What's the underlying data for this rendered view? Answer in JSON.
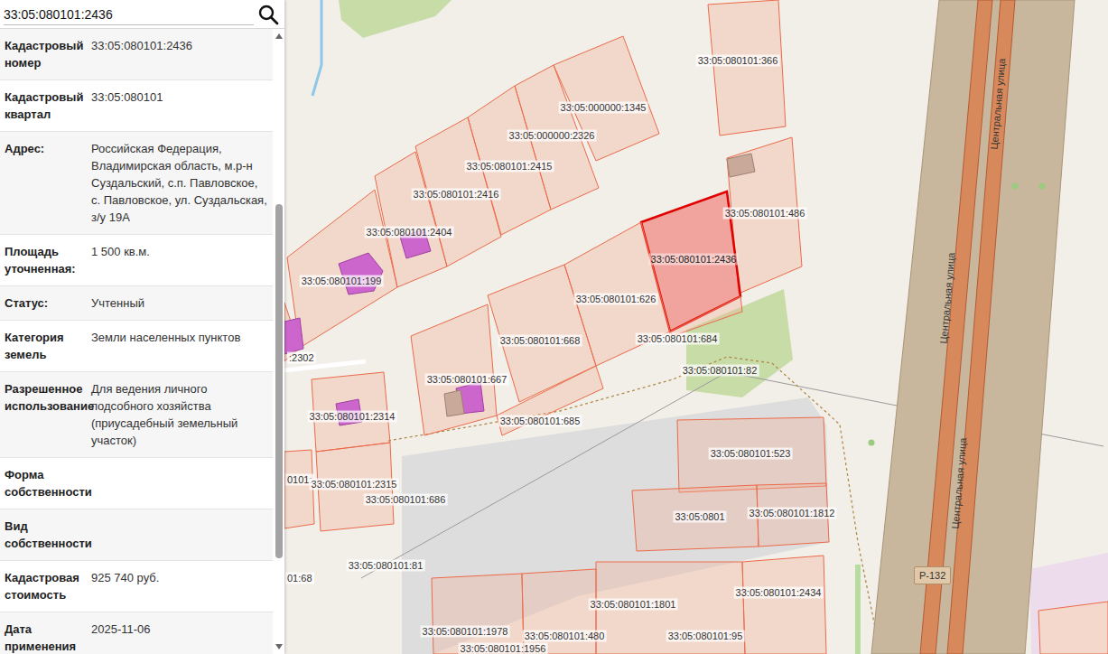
{
  "search": {
    "value": "33:05:080101:2436"
  },
  "details": [
    {
      "label": "Кадастровый номер",
      "value": "33:05:080101:2436"
    },
    {
      "label": "Кадастровый квартал",
      "value": "33:05:080101"
    },
    {
      "label": "Адрес:",
      "value": "Российская Федерация, Владимирская область, м.р-н Суздальский, с.п. Павловское, с. Павловское, ул. Суздальская, з/у 19А"
    },
    {
      "label": "Площадь уточненная:",
      "value": "1 500 кв.м."
    },
    {
      "label": "Статус:",
      "value": "Учтенный"
    },
    {
      "label": "Категория земель",
      "value": "Земли населенных пунктов"
    },
    {
      "label": "Разрешенное использование",
      "value": "Для ведения личного подсобного хозяйства (приусадебный земельный участок)"
    },
    {
      "label": "Форма собственности",
      "value": ""
    },
    {
      "label": "Вид собственности",
      "value": ""
    },
    {
      "label": "Кадастровая стоимость",
      "value": "925 740 руб."
    },
    {
      "label": "Дата применения",
      "value": "2025-11-06"
    }
  ],
  "map": {
    "parcels": [
      {
        "label": "33:05:080101:366",
        "selected": false
      },
      {
        "label": "33:05:000000:1345",
        "selected": false
      },
      {
        "label": "33:05:000000:2326",
        "selected": false
      },
      {
        "label": "33:05:080101:2415",
        "selected": false
      },
      {
        "label": "33:05:080101:2416",
        "selected": false
      },
      {
        "label": "33:05:080101:2404",
        "selected": false
      },
      {
        "label": "33:05:080101:199",
        "selected": false
      },
      {
        "label": ":2302",
        "selected": false
      },
      {
        "label": "33:05:080101:486",
        "selected": false
      },
      {
        "label": "33:05:080101:2436",
        "selected": true
      },
      {
        "label": "33:05:080101:626",
        "selected": false
      },
      {
        "label": "33:05:080101:668",
        "selected": false
      },
      {
        "label": "33:05:080101:667",
        "selected": false
      },
      {
        "label": "33:05:080101:685",
        "selected": false
      },
      {
        "label": "33:05:080101:684",
        "selected": false
      },
      {
        "label": "33:05:080101:82",
        "selected": false
      },
      {
        "label": "33:05:080101:2314",
        "selected": false
      },
      {
        "label": "0101:",
        "selected": false
      },
      {
        "label": "33:05:080101:2315",
        "selected": false
      },
      {
        "label": "33:05:080101:686",
        "selected": false
      },
      {
        "label": "33:05:080101:81",
        "selected": false
      },
      {
        "label": "01:68",
        "selected": false
      },
      {
        "label": "33:05:080101:523",
        "selected": false
      },
      {
        "label": "33:05:0801",
        "selected": false
      },
      {
        "label": "33:05:080101:1812",
        "selected": false
      },
      {
        "label": "33:05:080101:1801",
        "selected": false
      },
      {
        "label": "33:05:080101:2434",
        "selected": false
      },
      {
        "label": "33:05:080101:1978",
        "selected": false
      },
      {
        "label": "33:05:080101:480",
        "selected": false
      },
      {
        "label": "33:05:080101:95",
        "selected": false
      },
      {
        "label": "33:05:080101:1956",
        "selected": false
      }
    ],
    "streets": [
      "Центральная улица",
      "Центральная улица",
      "Центральная улица"
    ],
    "road_badge": "Р-132"
  }
}
